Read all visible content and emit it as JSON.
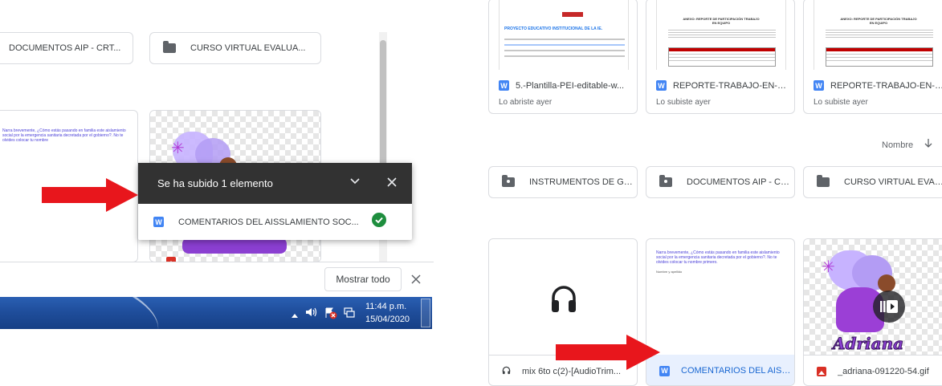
{
  "left": {
    "folders": [
      {
        "label": "DOCUMENTOS AIP - CRT..."
      },
      {
        "label": "CURSO VIRTUAL EVALUA..."
      }
    ],
    "card_preview_text": "Narra brevemente, ¿Cómo estás pasando en familia este aislamiento social por la emergencia sanitaria decretada por el gobierno?. No te olvides colocar tu nombre",
    "upload_toast": {
      "title": "Se ha subido 1 elemento",
      "file_name": "COMENTARIOS DEL AISSLAMIENTO SOC...",
      "file_icon_letter": "W"
    },
    "downloads_bar": {
      "show_all_label": "Mostrar todo"
    },
    "taskbar": {
      "time": "11:44 p.m.",
      "date": "15/04/2020"
    }
  },
  "right": {
    "recent_files": [
      {
        "name": "5.-Plantilla-PEI-editable-w...",
        "subtitle": "Lo abriste ayer",
        "icon_letter": "W"
      },
      {
        "name": "REPORTE-TRABAJO-EN-E...",
        "subtitle": "Lo subiste ayer",
        "icon_letter": "W"
      },
      {
        "name": "REPORTE-TRABAJO-EN-E...",
        "subtitle": "Lo subiste ayer",
        "icon_letter": "W"
      }
    ],
    "doc_thumb_heading": "PROYECTO EDUCATIVO INSTITUCIONAL DE LA IE.",
    "report_thumb_heading": "ANEXO: REPORTE DE PARTICIPACIÓN TRABAJO EN EQUIPO",
    "sort_label": "Nombre",
    "folders": [
      {
        "label": "INSTRUMENTOS DE GES..."
      },
      {
        "label": "DOCUMENTOS AIP - CRT..."
      },
      {
        "label": "CURSO VIRTUAL EVALUA..."
      }
    ],
    "files": [
      {
        "name": "mix 6to c(2)-[AudioTrim...",
        "type": "audio"
      },
      {
        "name": "COMENTARIOS DEL AISS...",
        "type": "word",
        "icon_letter": "W"
      },
      {
        "name": "_adriana-091220-54.gif",
        "type": "image"
      }
    ],
    "comment_preview": "Narra brevemente, ¿Cómo estás pasando en familia este aislamiento social por la emergencia sanitaria decretada por el gobierno?. No te olvides colocar tu nombre primero.",
    "comment_preview_name": "Nombre y apellido",
    "gif_text": "Adriana"
  },
  "colors": {
    "arrow_red": "#e8161c",
    "toast_bg": "#323232",
    "word_blue": "#4285f4",
    "check_green": "#1e8e3e",
    "taskbar_blue": "#1f4e9c",
    "selected_bg": "#e8f0fe"
  }
}
